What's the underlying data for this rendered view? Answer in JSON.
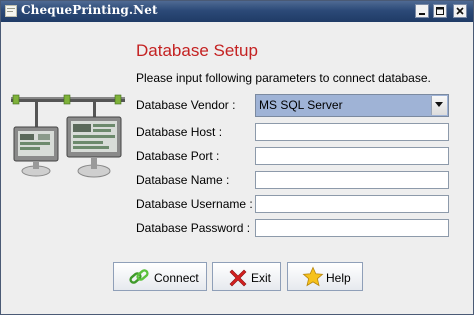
{
  "window": {
    "title": "ChequePrinting.Net"
  },
  "dialog": {
    "heading": "Database Setup",
    "intro": "Please input following parameters to connect database."
  },
  "form": {
    "vendor_label": "Database Vendor :",
    "vendor_value": "MS SQL Server",
    "host_label": "Database Host :",
    "host_value": "",
    "port_label": "Database Port :",
    "port_value": "",
    "name_label": "Database Name :",
    "name_value": "",
    "username_label": "Database Username :",
    "username_value": "",
    "password_label": "Database Password :",
    "password_value": ""
  },
  "buttons": {
    "connect_label": "Connect",
    "exit_label": "Exit",
    "help_label": "Help"
  },
  "icons": {
    "connect": "chain-link-icon",
    "exit": "red-x-icon",
    "help": "star-icon",
    "illustration": "network-computers-icon"
  },
  "colors": {
    "heading": "#c42222",
    "titlebar": "#2c4a78",
    "selection": "#9fb3d6"
  }
}
